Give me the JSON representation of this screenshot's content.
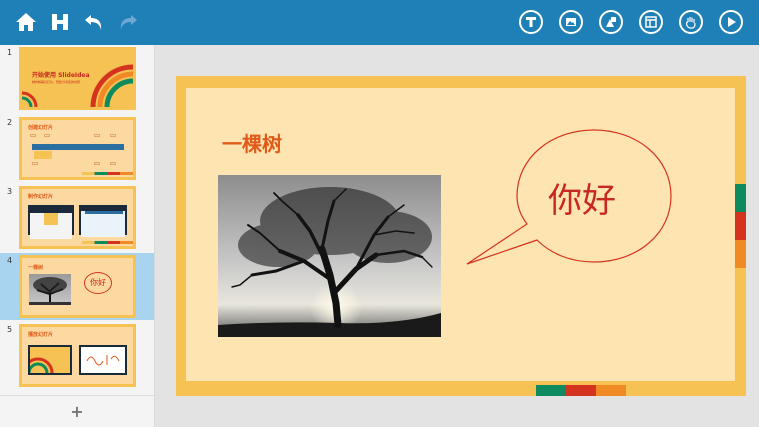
{
  "toolbar": {
    "left_icons": [
      "home-icon",
      "save-icon",
      "undo-icon",
      "redo-icon"
    ],
    "right_icons": [
      "text-icon",
      "image-icon",
      "shapes-icon",
      "layout-icon",
      "touch-icon",
      "play-icon"
    ],
    "background": "#1f7fb7"
  },
  "sidebar": {
    "slides": [
      {
        "num": "1",
        "title": "开始使用 SlideIdea",
        "subtitle": "制作精美幻灯片，轻松分享您的创意"
      },
      {
        "num": "2",
        "title": "创建幻灯片"
      },
      {
        "num": "3",
        "title": "制作幻灯片"
      },
      {
        "num": "4",
        "title": "一棵树",
        "bubble": "你好"
      },
      {
        "num": "5",
        "title": "播放幻灯片"
      }
    ],
    "selected_index": 3,
    "add_label": "+"
  },
  "slide": {
    "title": "一棵树",
    "bubble_text": "你好",
    "accent": "#e05a1a",
    "bubble_color": "#c8281e",
    "stripe_colors": [
      "#f6c253",
      "#0e8a5f",
      "#d4341f",
      "#f08a24",
      "#f6c253"
    ]
  }
}
